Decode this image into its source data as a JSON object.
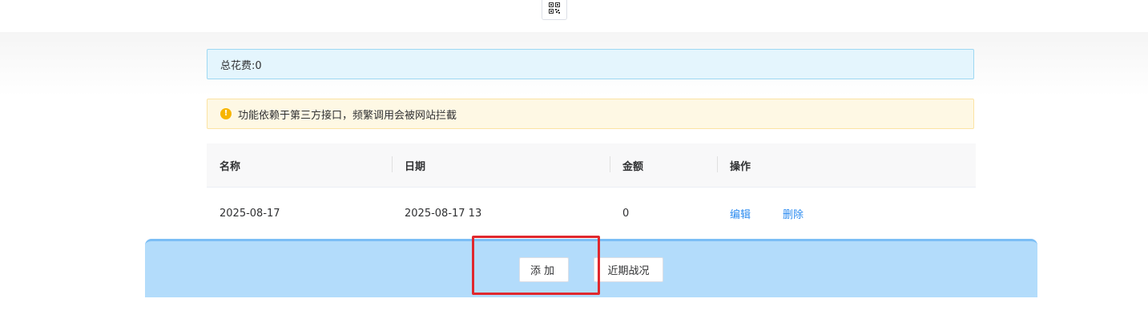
{
  "header": {
    "qr_icon": "qr-code-icon"
  },
  "summary": {
    "total_label": "总花费:0"
  },
  "notice": {
    "icon": "warning-icon",
    "icon_glyph": "!",
    "text": "功能依赖于第三方接口，频繁调用会被网站拦截",
    "color": "#f7b500"
  },
  "table": {
    "columns": [
      "名称",
      "日期",
      "金额",
      "操作"
    ],
    "rows": [
      {
        "name": "2025-08-17",
        "date": "2025-08-17 13",
        "amount": "0",
        "actions": [
          "编辑",
          "删除"
        ]
      }
    ]
  },
  "footer": {
    "add_label": "添加",
    "recent_label": "近期战况"
  },
  "colors": {
    "link": "#2d8cf0",
    "highlight": "#e0282e",
    "footer_bg": "#b3dcfb"
  }
}
